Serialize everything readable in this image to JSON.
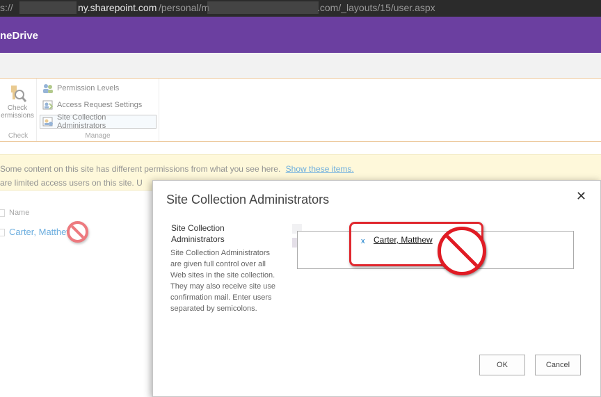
{
  "browser": {
    "scheme_fragment": "s://",
    "host": "ny.sharepoint.com",
    "path_part": "/personal/m",
    "domain_end": ".com/_layouts/15/user.aspx"
  },
  "suite_bar": {
    "app_name": "neDrive",
    "color": "#6b3fa0"
  },
  "ribbon": {
    "check_group": {
      "button_label_line1": "Check",
      "button_label_line2": "ermissions",
      "group_label": "Check"
    },
    "manage_group": {
      "items": [
        {
          "label": "Permission Levels",
          "icon": "permission-levels-icon"
        },
        {
          "label": "Access Request Settings",
          "icon": "access-request-icon"
        },
        {
          "label": "Site Collection Administrators",
          "icon": "site-admins-icon"
        }
      ],
      "group_label": "Manage"
    }
  },
  "notice": {
    "line1_text": "Some content on this site has different permissions from what you see here.",
    "line1_link": "Show these items.",
    "line2_text": "are limited access users on this site. U"
  },
  "list": {
    "column_name": "Name",
    "rows": [
      {
        "name": "Carter, Matthew"
      }
    ]
  },
  "dialog": {
    "title": "Site Collection Administrators",
    "close_symbol": "✕",
    "section_title": "Site Collection Administrators",
    "section_description": "Site Collection Administrators are given full control over all Web sites in the site collection. They may also receive site use confirmation mail. Enter users separated by semicolons.",
    "people_picker": {
      "remove_symbol": "x",
      "entries": [
        "Carter, Matthew"
      ]
    },
    "ok_label": "OK",
    "cancel_label": "Cancel"
  },
  "annotation_color": "#e01b24"
}
